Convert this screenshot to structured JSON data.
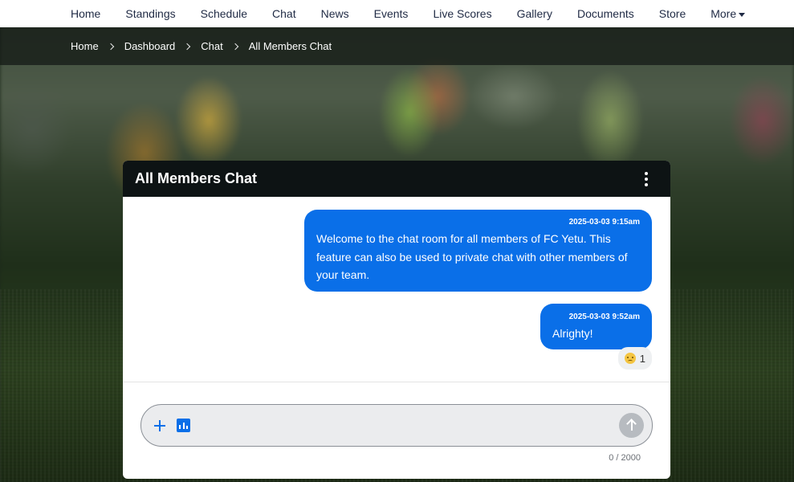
{
  "nav": {
    "items": [
      {
        "label": "Home"
      },
      {
        "label": "Standings"
      },
      {
        "label": "Schedule"
      },
      {
        "label": "Chat"
      },
      {
        "label": "News"
      },
      {
        "label": "Events"
      },
      {
        "label": "Live Scores"
      },
      {
        "label": "Gallery"
      },
      {
        "label": "Documents"
      },
      {
        "label": "Store"
      },
      {
        "label": "More"
      }
    ]
  },
  "breadcrumb": {
    "items": [
      {
        "label": "Home"
      },
      {
        "label": "Dashboard"
      },
      {
        "label": "Chat"
      },
      {
        "label": "All Members Chat"
      }
    ]
  },
  "chat": {
    "title": "All Members Chat",
    "messages": [
      {
        "timestamp": "2025-03-03 9:15am",
        "text": "Welcome to the chat room for all members of FC Yetu. This feature can also be used to private chat with other members of your team."
      },
      {
        "timestamp": "2025-03-03 9:52am",
        "text": "Alrighty!",
        "reaction": {
          "icon": "frowning-face-emoji",
          "count": "1"
        }
      }
    ],
    "composer": {
      "placeholder": "",
      "counter": "0 / 2000"
    }
  },
  "colors": {
    "accent": "#0a6fe8",
    "header": "#0d1314",
    "nav_text": "#1f2a44"
  }
}
